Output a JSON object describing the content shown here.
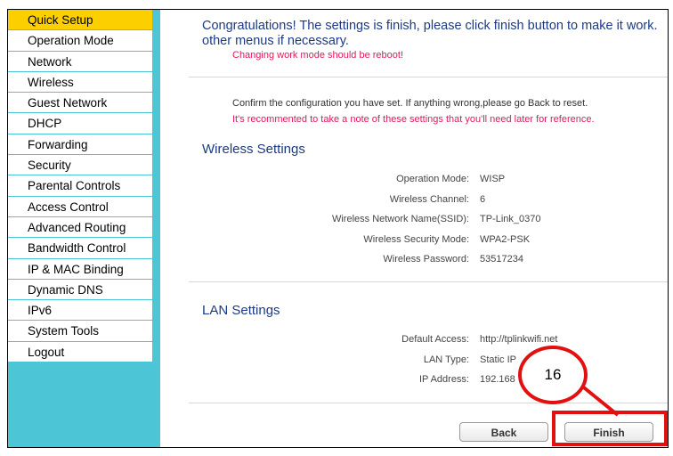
{
  "sidebar": {
    "items": [
      {
        "label": "Quick Setup",
        "active": true
      },
      {
        "label": "Operation Mode"
      },
      {
        "label": "Network"
      },
      {
        "label": "Wireless"
      },
      {
        "label": "Guest Network"
      },
      {
        "label": "DHCP"
      },
      {
        "label": "Forwarding"
      },
      {
        "label": "Security"
      },
      {
        "label": "Parental Controls"
      },
      {
        "label": "Access Control"
      },
      {
        "label": "Advanced Routing"
      },
      {
        "label": "Bandwidth Control"
      },
      {
        "label": "IP & MAC Binding"
      },
      {
        "label": "Dynamic DNS"
      },
      {
        "label": "IPv6"
      },
      {
        "label": "System Tools"
      },
      {
        "label": "Logout"
      }
    ]
  },
  "main": {
    "headline": "Congratulations! The settings is finish, please click finish button to make it work. other menus if necessary.",
    "reboot_note": "Changing work mode should be reboot!",
    "confirm_text": "Confirm the configuration you have set. If anything wrong,please go Back to reset.",
    "recommend_text": "It's recommented to take a note of these settings that you'll need later for reference.",
    "wireless": {
      "title": "Wireless Settings",
      "rows": [
        {
          "label": "Operation Mode:",
          "value": "WISP"
        },
        {
          "label": "Wireless Channel:",
          "value": "6"
        },
        {
          "label": "Wireless Network Name(SSID):",
          "value": "TP-Link_0370"
        },
        {
          "label": "Wireless Security Mode:",
          "value": "WPA2-PSK"
        },
        {
          "label": "Wireless Password:",
          "value": "53517234"
        }
      ]
    },
    "lan": {
      "title": "LAN Settings",
      "rows": [
        {
          "label": "Default Access:",
          "value": "http://tplinkwifi.net"
        },
        {
          "label": "LAN Type:",
          "value": "Static IP"
        },
        {
          "label": "IP Address:",
          "value": "192.168"
        }
      ]
    },
    "buttons": {
      "back": "Back",
      "finish": "Finish"
    }
  },
  "annotation": {
    "step_number": "16",
    "color": "#e31010"
  },
  "colors": {
    "sidebar": "#4cc6d6",
    "active_item": "#fcd000",
    "heading": "#1c3a84",
    "warning": "#e0195a"
  }
}
